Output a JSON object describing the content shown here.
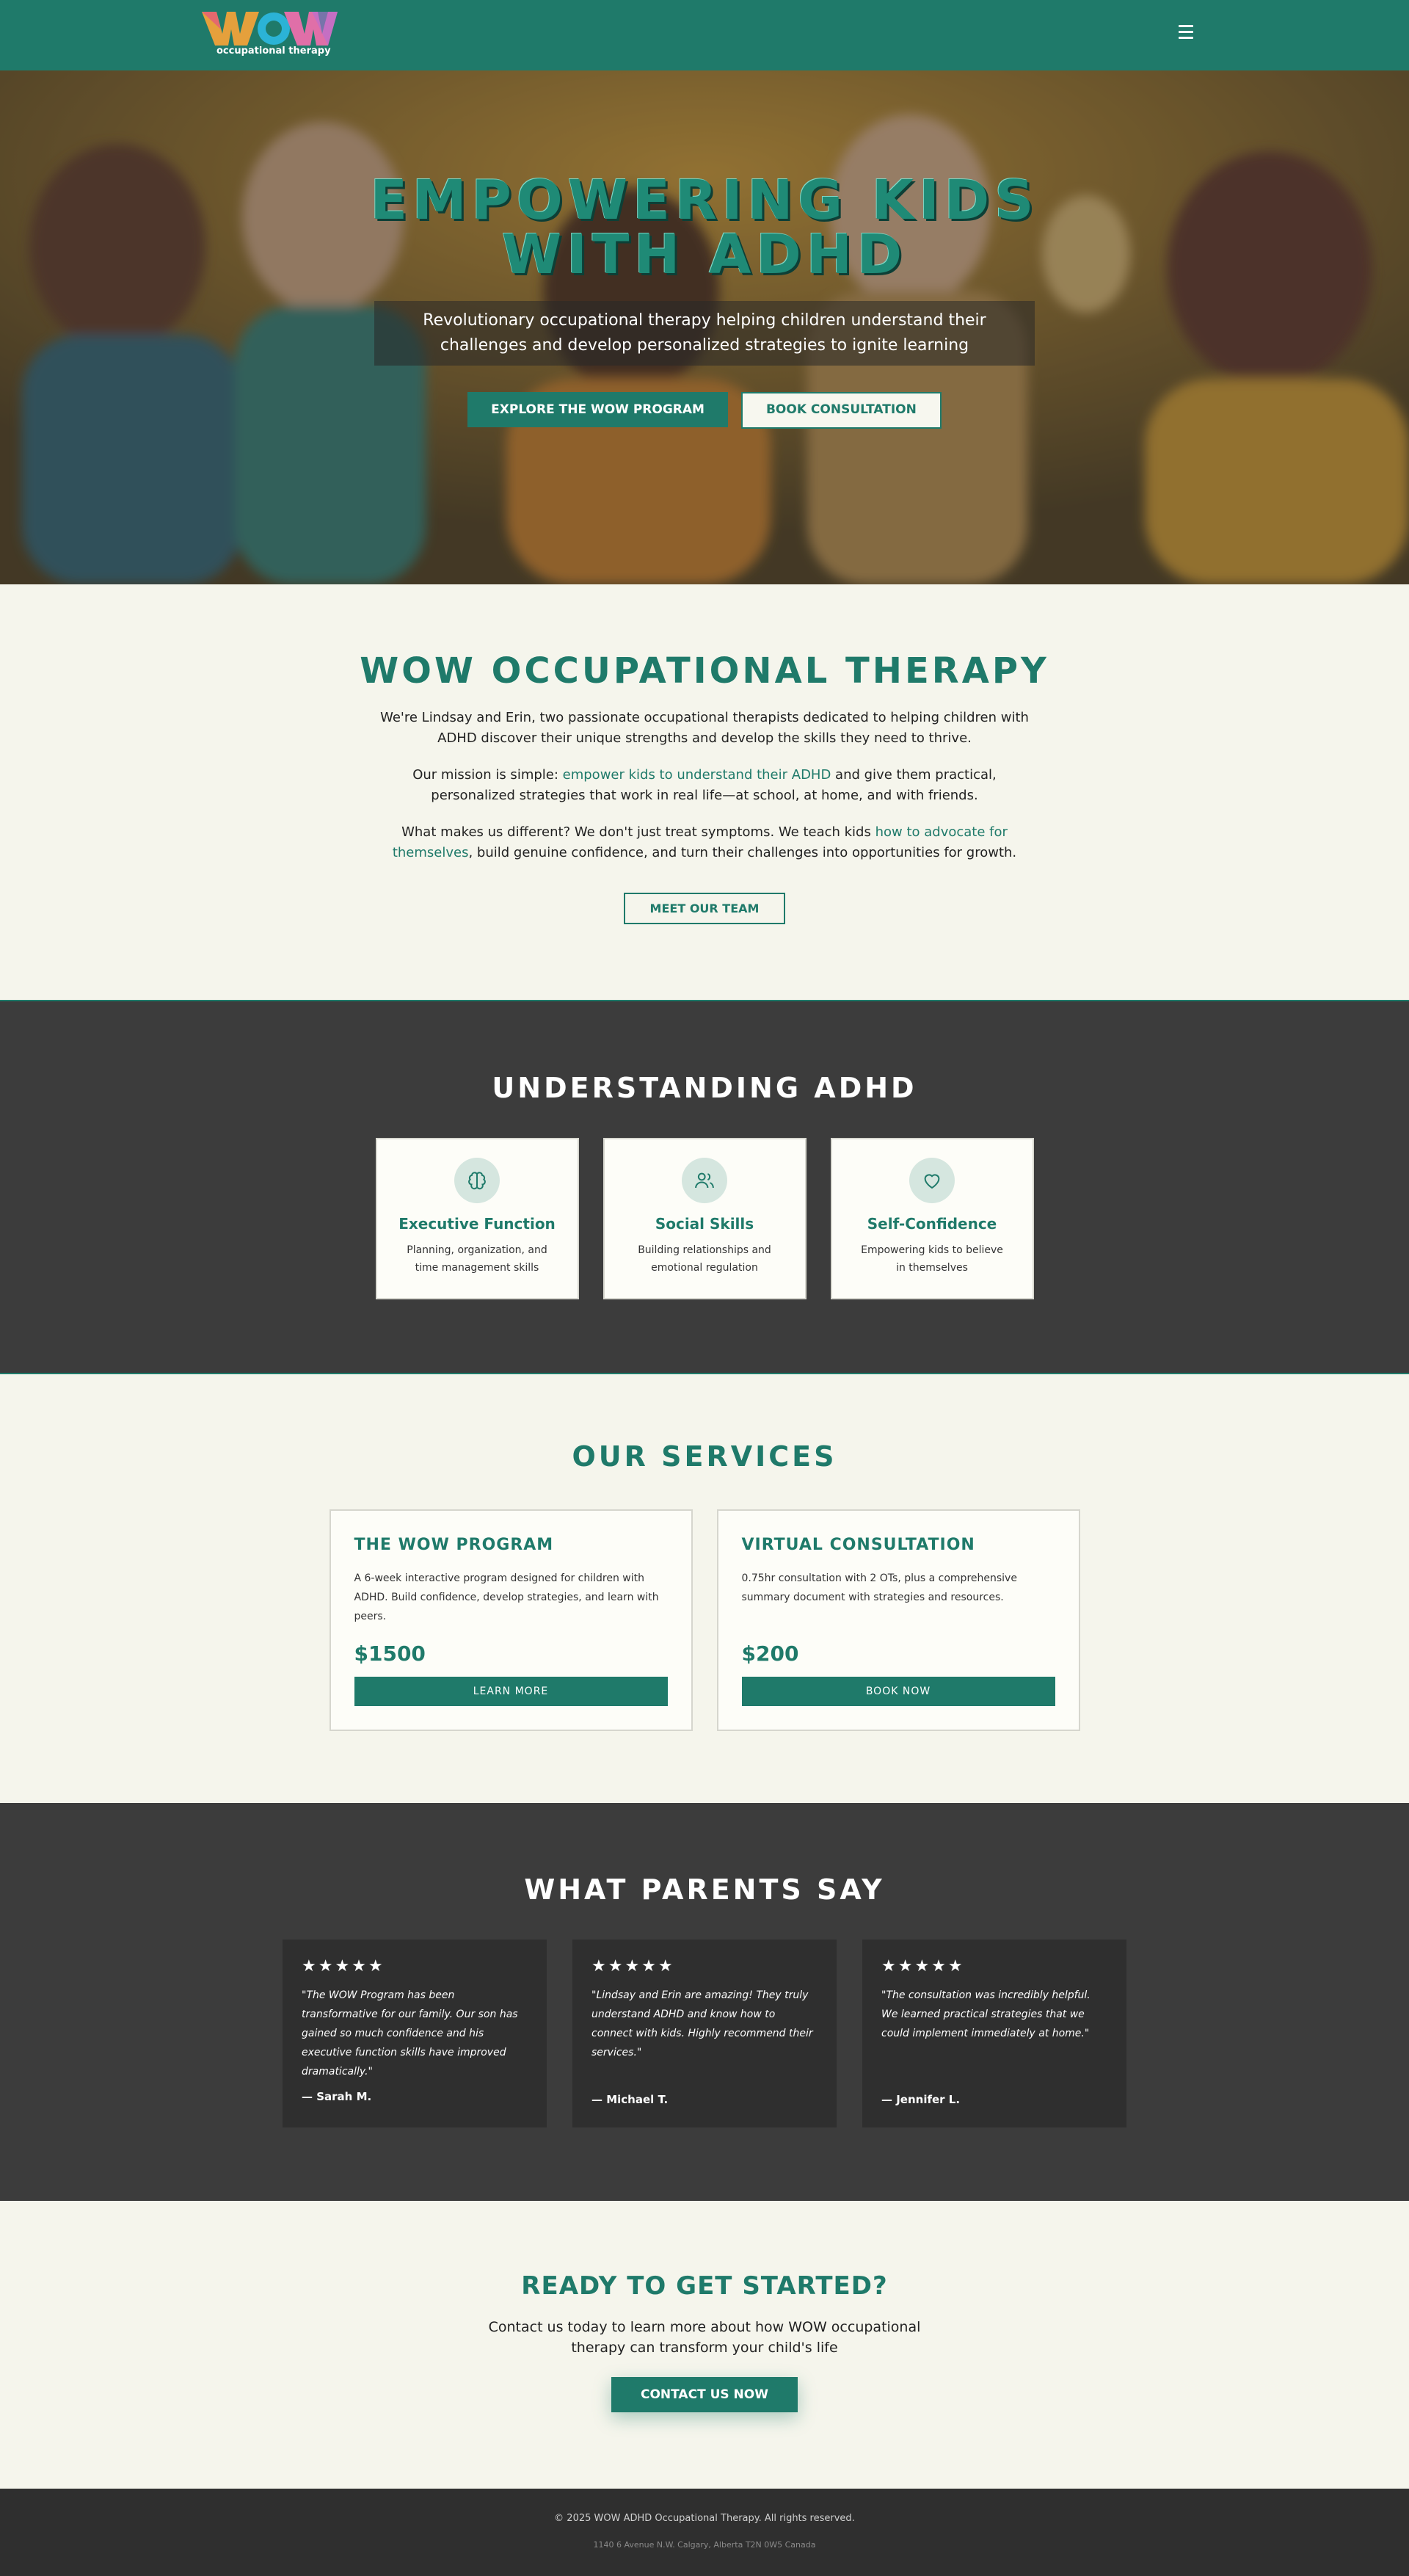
{
  "nav": {
    "logo_text": "WOW",
    "logo_sub": "occupational therapy",
    "menu_icon": "hamburger-icon"
  },
  "hero": {
    "title_line1": "EMPOWERING KIDS",
    "title_line2": "WITH ADHD",
    "subtitle": "Revolutionary occupational therapy helping children understand their challenges and develop personalized strategies to ignite learning",
    "primary_button": "EXPLORE THE WOW PROGRAM",
    "secondary_button": "BOOK CONSULTATION"
  },
  "about": {
    "title": "WOW OCCUPATIONAL THERAPY",
    "para1": "We're Lindsay and Erin, two passionate occupational therapists dedicated to helping children with ADHD discover their unique strengths and develop the skills they need to thrive.",
    "para2_before": "Our mission is simple: ",
    "para2_highlight": "empower kids to understand their ADHD",
    "para2_after": " and give them practical, personalized strategies that work in real life—at school, at home, and with friends.",
    "para3_before": "What makes us different? We don't just treat symptoms. We teach kids ",
    "para3_highlight": "how to advocate for themselves",
    "para3_after": ", build genuine confidence, and turn their challenges into opportunities for growth.",
    "button": "MEET OUR TEAM"
  },
  "adhd": {
    "title": "UNDERSTANDING ADHD",
    "cards": [
      {
        "icon": "brain-icon",
        "title": "Executive Function",
        "text": "Planning, organization, and time management skills"
      },
      {
        "icon": "users-icon",
        "title": "Social Skills",
        "text": "Building relationships and emotional regulation"
      },
      {
        "icon": "heart-icon",
        "title": "Self-Confidence",
        "text": "Empowering kids to believe in themselves"
      }
    ]
  },
  "services": {
    "title": "OUR SERVICES",
    "items": [
      {
        "title": "THE WOW PROGRAM",
        "text": "A 6-week interactive program designed for children with ADHD. Build confidence, develop strategies, and learn with peers.",
        "price": "$1500",
        "button": "LEARN MORE"
      },
      {
        "title": "VIRTUAL CONSULTATION",
        "text": "0.75hr consultation with 2 OTs, plus a comprehensive summary document with strategies and resources.",
        "price": "$200",
        "button": "BOOK NOW"
      }
    ]
  },
  "testimonials": {
    "title": "WHAT PARENTS SAY",
    "stars": "★★★★★",
    "items": [
      {
        "quote": "\"The WOW Program has been transformative for our family. Our son has gained so much confidence and his executive function skills have improved dramatically.\"",
        "author": "— Sarah M."
      },
      {
        "quote": "\"Lindsay and Erin are amazing! They truly understand ADHD and know how to connect with kids. Highly recommend their services.\"",
        "author": "— Michael T."
      },
      {
        "quote": "\"The consultation was incredibly helpful. We learned practical strategies that we could implement immediately at home.\"",
        "author": "— Jennifer L."
      }
    ]
  },
  "cta": {
    "title": "READY TO GET STARTED?",
    "text": "Contact us today to learn more about how WOW occupational therapy can transform your child's life",
    "button": "CONTACT US NOW"
  },
  "footer": {
    "copyright": "© 2025 WOW ADHD Occupational Therapy. All rights reserved.",
    "address": "1140 6 Avenue N.W. Calgary, Alberta T2N 0W5 Canada"
  },
  "colors": {
    "brand": "#1f7a6a",
    "dark_section": "#3c3c3c",
    "cream": "#f5f5ec"
  }
}
